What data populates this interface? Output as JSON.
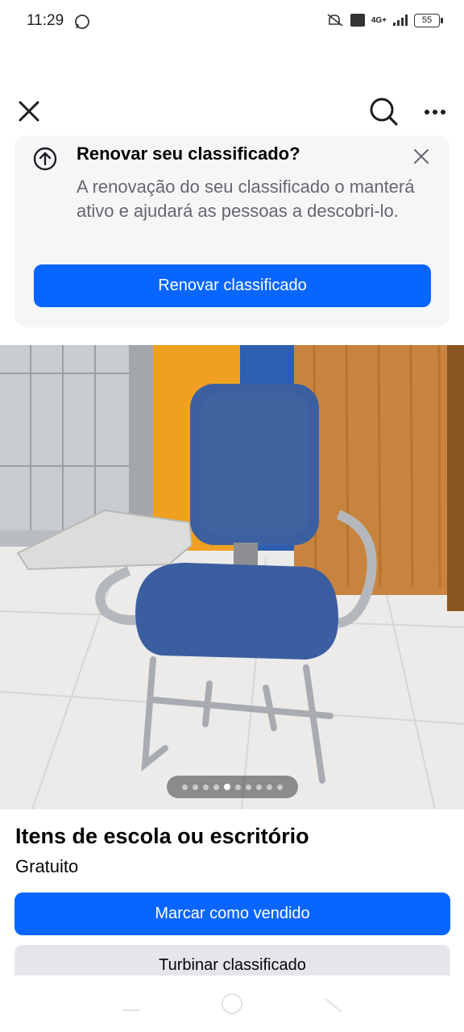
{
  "status_bar": {
    "time": "11:29",
    "network": "4G+",
    "battery": "55"
  },
  "app_bar": {
    "close": "close-icon",
    "search": "search-icon",
    "more": "more-icon"
  },
  "renew_card": {
    "title": "Renovar seu classificado?",
    "body": "A renovação do seu classificado o manterá ativo e ajudará as pessoas a descobri-lo.",
    "button": "Renovar classificado"
  },
  "photo": {
    "pages": 10,
    "active_page": 5
  },
  "listing": {
    "title": "Itens de escola ou escritório",
    "price": "Gratuito",
    "mark_sold": "Marcar como vendido",
    "boost": "Turbinar classificado"
  },
  "colors": {
    "accent": "#0866ff",
    "secondary_button": "#e4e6eb"
  }
}
